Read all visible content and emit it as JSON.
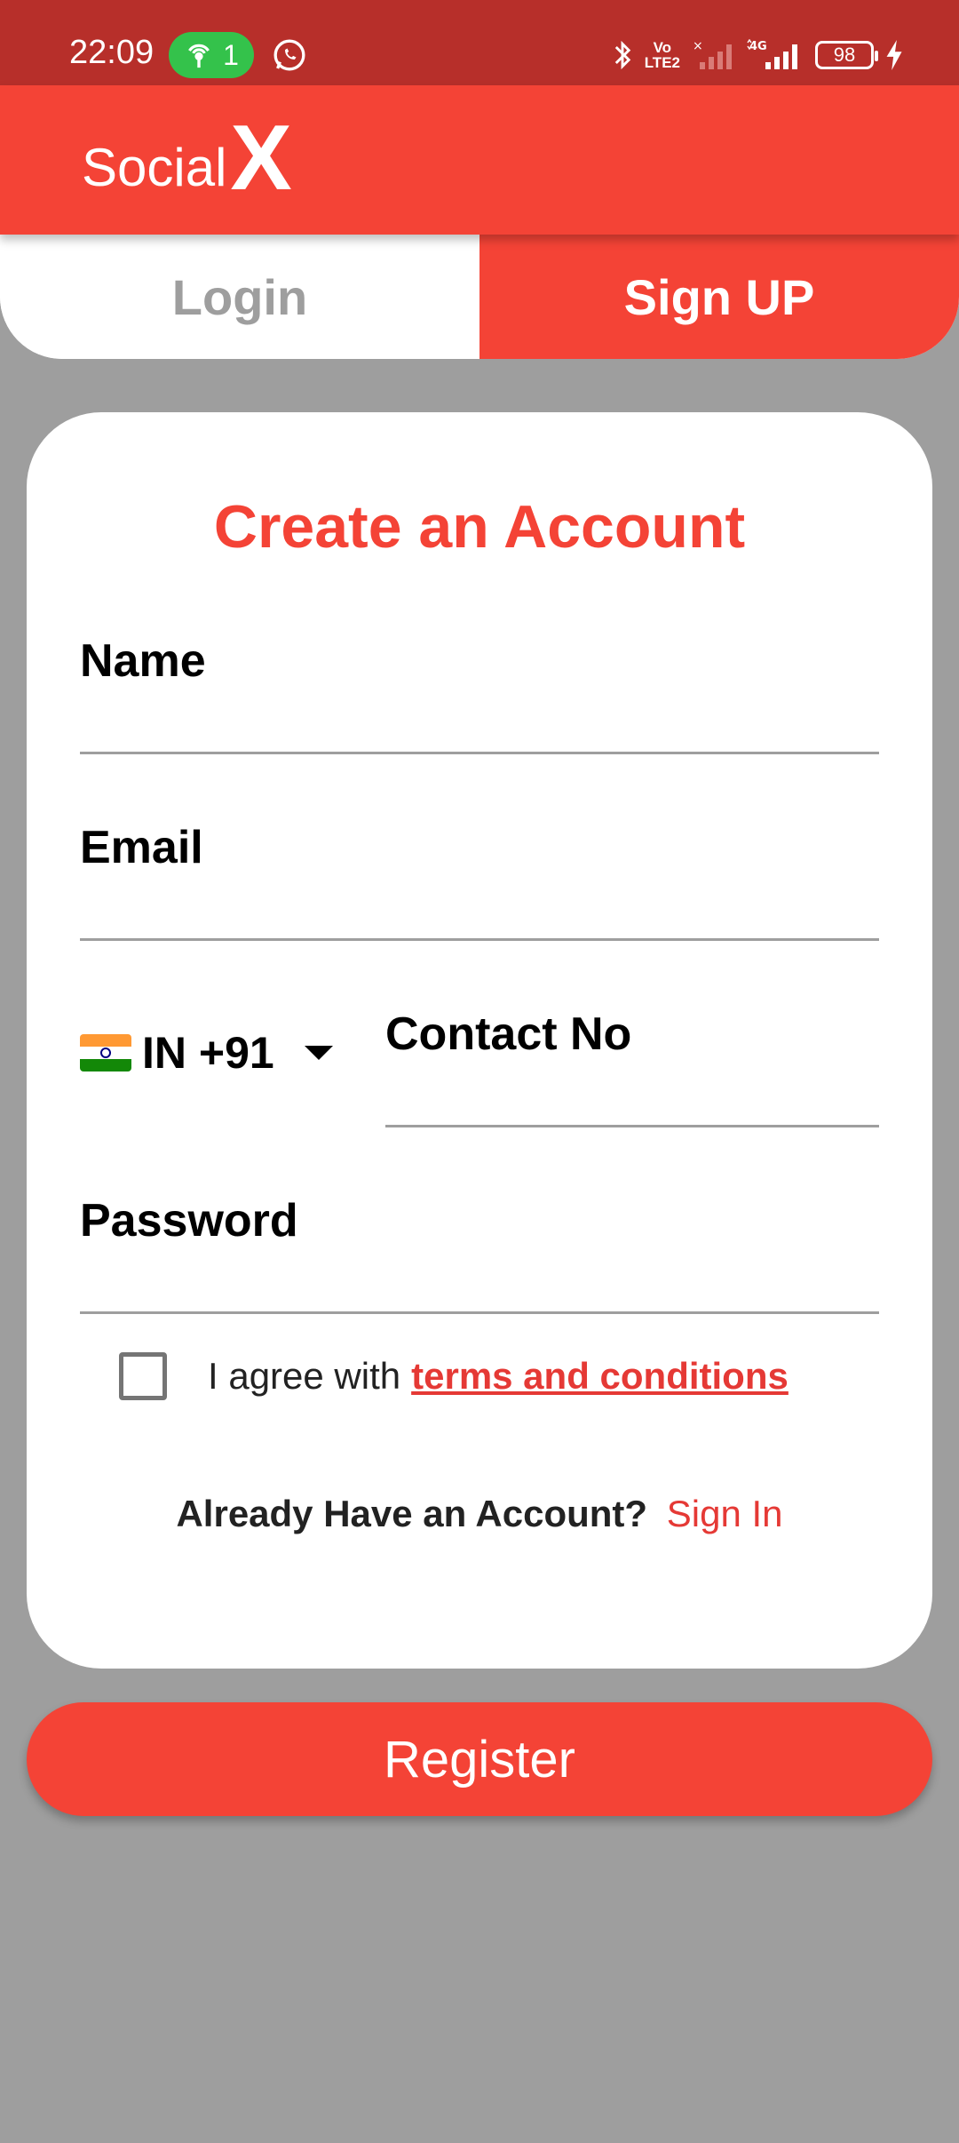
{
  "status_bar": {
    "time": "22:09",
    "hotspot_count": "1",
    "battery": "98",
    "lte_label_top": "Vo",
    "lte_label_bottom": "LTE2",
    "network_label": "4G"
  },
  "app_bar": {
    "brand_social": "Social",
    "brand_x": "X"
  },
  "tabs": {
    "login": "Login",
    "signup": "Sign UP",
    "active": "signup"
  },
  "form": {
    "title": "Create an Account",
    "name_label": "Name",
    "email_label": "Email",
    "country_code": "IN +91",
    "contact_label": "Contact No",
    "password_label": "Password",
    "agree_text": "I agree with",
    "terms_link": "terms and conditions",
    "agree_checked": false,
    "already_text": "Already Have an Account?",
    "signin_link": "Sign In"
  },
  "register_button": "Register",
  "colors": {
    "primary": "#f44336",
    "status_bar": "#b72f2a",
    "background": "#9e9e9e",
    "hotspot": "#34c24b"
  }
}
